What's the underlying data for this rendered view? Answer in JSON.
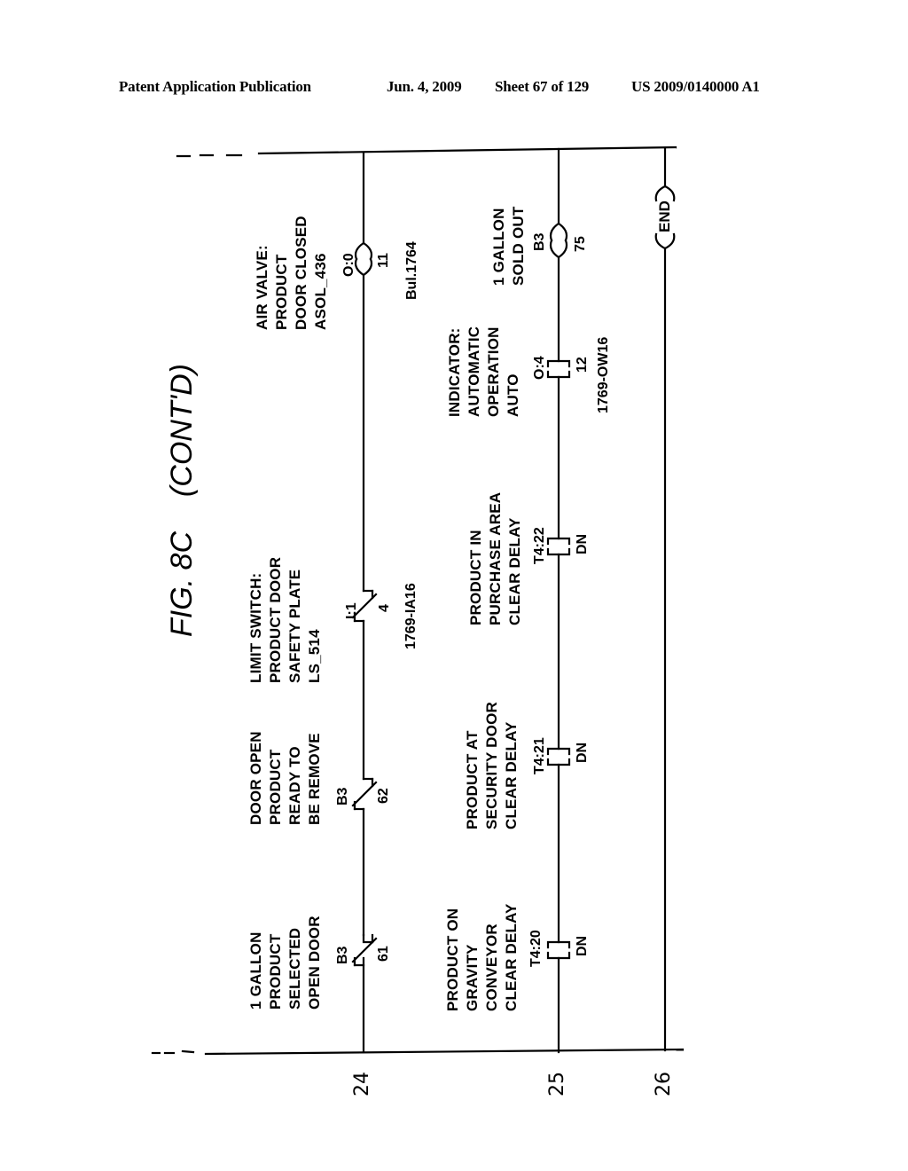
{
  "header": {
    "publication": "Patent Application Publication",
    "date": "Jun. 4, 2009",
    "sheet": "Sheet 67 of 129",
    "patent_number": "US 2009/0140000 A1"
  },
  "figure": {
    "title_prefix": "FIG. 8C",
    "title_suffix": "(CONT'D)"
  },
  "rungs": [
    {
      "number": "24",
      "elements": [
        {
          "type": "normally-closed-contact",
          "lines": [
            "1 GALLON",
            "PRODUCT",
            "SELECTED",
            "OPEN DOOR"
          ],
          "address": "B3",
          "bit": "61"
        },
        {
          "type": "normally-closed-contact",
          "lines": [
            "DOOR OPEN",
            "PRODUCT",
            "READY TO",
            "BE REMOVE"
          ],
          "address": "B3",
          "bit": "62"
        },
        {
          "type": "normally-closed-contact",
          "lines": [
            "LIMIT SWITCH:",
            "PRODUCT DOOR",
            "SAFETY PLATE",
            "LS_514"
          ],
          "address": "I:1",
          "bit": "4",
          "module": "1769-IA16"
        },
        {
          "type": "output-coil",
          "lines": [
            "AIR VALVE:",
            "PRODUCT",
            "DOOR CLOSED",
            "ASOL_436"
          ],
          "address": "O:0",
          "bit": "11",
          "module": "Bul.1764"
        }
      ]
    },
    {
      "number": "25",
      "elements": [
        {
          "type": "normally-open-contact",
          "lines": [
            "PRODUCT ON",
            "GRAVITY",
            "CONVEYOR",
            "CLEAR DELAY"
          ],
          "address": "T4:20",
          "bit": "DN"
        },
        {
          "type": "normally-open-contact",
          "lines": [
            "PRODUCT AT",
            "SECURITY DOOR",
            "CLEAR DELAY"
          ],
          "address": "T4:21",
          "bit": "DN"
        },
        {
          "type": "normally-open-contact",
          "lines": [
            "PRODUCT IN",
            "PURCHASE AREA",
            "CLEAR DELAY"
          ],
          "address": "T4:22",
          "bit": "DN"
        },
        {
          "type": "normally-open-contact",
          "lines": [
            "INDICATOR:",
            "AUTOMATIC",
            "OPERATION",
            "AUTO"
          ],
          "address": "O:4",
          "bit": "12",
          "module": "1769-OW16"
        },
        {
          "type": "output-coil",
          "lines": [
            "1 GALLON",
            "SOLD OUT"
          ],
          "address": "B3",
          "bit": "75"
        }
      ]
    },
    {
      "number": "26",
      "elements": [
        {
          "type": "end-instruction",
          "label": "END"
        }
      ]
    }
  ]
}
